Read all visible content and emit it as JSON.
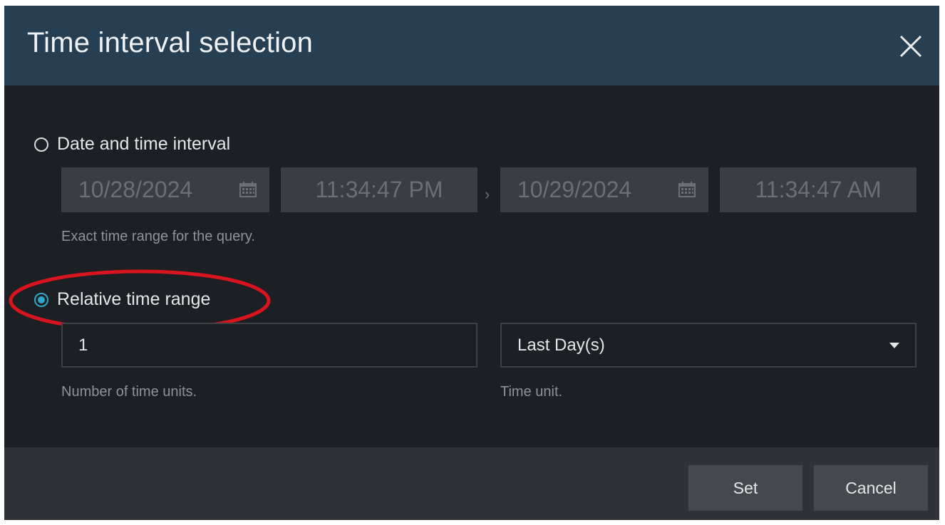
{
  "dialog": {
    "title": "Time interval selection"
  },
  "date_interval": {
    "label": "Date and time interval",
    "selected": false,
    "start_date": "10/28/2024",
    "start_time": "11:34:47 PM",
    "end_date": "10/29/2024",
    "end_time": "11:34:47 AM",
    "separator": "›",
    "hint": "Exact time range for the query."
  },
  "relative_range": {
    "label": "Relative time range",
    "selected": true,
    "count_value": "1",
    "count_hint": "Number of time units.",
    "unit_value": "Last Day(s)",
    "unit_hint": "Time unit."
  },
  "footer": {
    "set_label": "Set",
    "cancel_label": "Cancel"
  },
  "icons": {
    "close": "close-icon",
    "calendar": "calendar-icon",
    "dropdown": "chevron-down-icon"
  },
  "colors": {
    "title_bar": "#263f52",
    "dialog_bg": "#1c1f23",
    "footer_bg": "#2f3236",
    "accent": "#2fa7c8",
    "annotation": "#d9141e"
  }
}
